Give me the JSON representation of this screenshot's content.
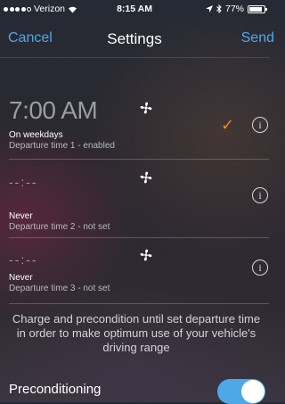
{
  "status_bar": {
    "carrier": "Verizon",
    "time": "8:15 AM",
    "battery": "77%"
  },
  "nav": {
    "cancel": "Cancel",
    "title": "Settings",
    "send": "Send"
  },
  "departures": [
    {
      "time": "7:00 AM",
      "days": "On weekdays",
      "subtitle": "Departure time 1 - enabled",
      "checked": true
    },
    {
      "time": "--:--",
      "days": "Never",
      "subtitle": "Departure time 2 - not set",
      "checked": false
    },
    {
      "time": "--:--",
      "days": "Never",
      "subtitle": "Departure time 3 - not set",
      "checked": false
    }
  ],
  "icons": {
    "fan": "fan-icon",
    "check": "checkmark-icon",
    "info": "info-icon"
  },
  "info_glyph": "i",
  "check_glyph": "✓",
  "description": "Charge and precondition until set departure time in order to make optimum use of your vehicle's driving range",
  "preconditioning": {
    "label": "Preconditioning",
    "enabled": true
  },
  "colors": {
    "accent": "#4da8e8",
    "check": "#f08a22"
  }
}
